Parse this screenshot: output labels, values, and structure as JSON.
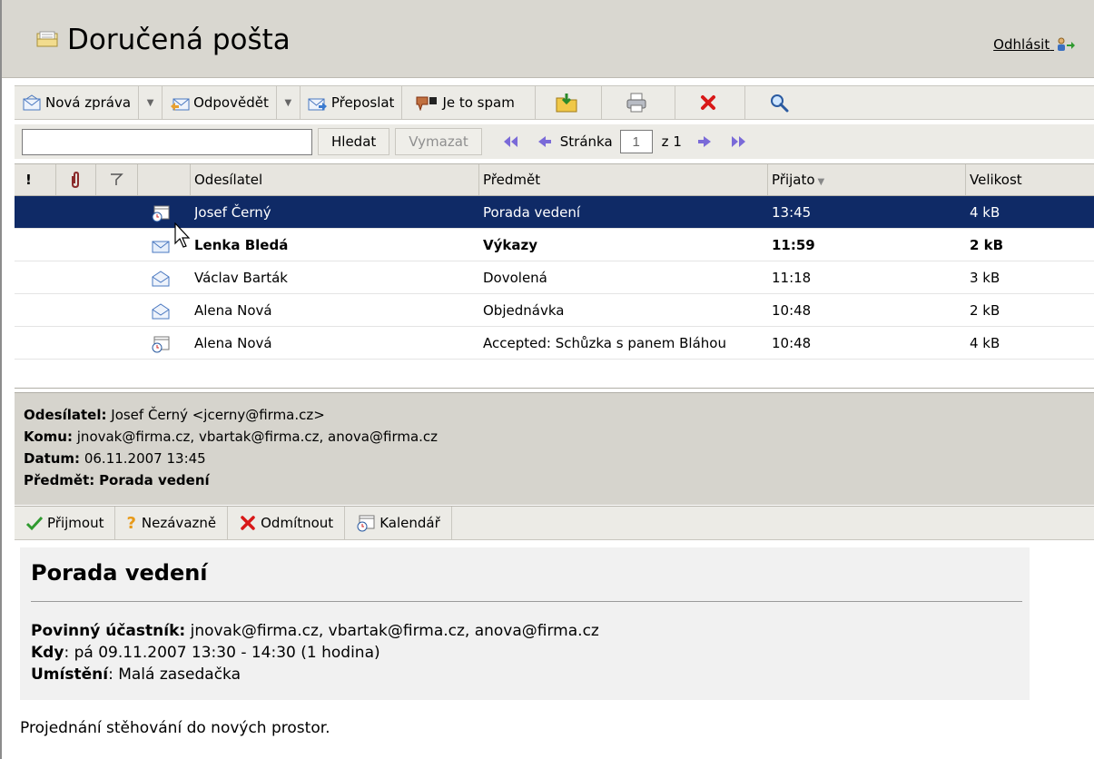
{
  "header": {
    "title": "Doručená pošta",
    "logout_label": "Odhlásit"
  },
  "toolbar": {
    "new_message": "Nová zpráva",
    "reply": "Odpovědět",
    "forward": "Přeposlat",
    "spam": "Je to spam"
  },
  "search": {
    "value": "",
    "search_label": "Hledat",
    "clear_label": "Vymazat",
    "page_label": "Stránka",
    "page_value": "1",
    "page_total": "z 1"
  },
  "columns": {
    "importance": "!",
    "sender": "Odesílatel",
    "subject": "Předmět",
    "received": "Přijato",
    "size": "Velikost"
  },
  "messages": [
    {
      "sender": "Josef Černý",
      "subject": "Porada vedení",
      "time": "13:45",
      "size": "4 kB",
      "icon": "meeting-request-icon",
      "selected": true,
      "unread": false
    },
    {
      "sender": "Lenka Bledá",
      "subject": "Výkazy",
      "time": "11:59",
      "size": "2 kB",
      "icon": "unread-envelope-icon",
      "selected": false,
      "unread": true
    },
    {
      "sender": "Václav Barták",
      "subject": "Dovolená",
      "time": "11:18",
      "size": "3 kB",
      "icon": "read-envelope-icon",
      "selected": false,
      "unread": false
    },
    {
      "sender": "Alena Nová",
      "subject": "Objednávka",
      "time": "10:48",
      "size": "2 kB",
      "icon": "read-envelope-icon",
      "selected": false,
      "unread": false
    },
    {
      "sender": "Alena Nová",
      "subject": "Accepted: Schůzka s panem Bláhou",
      "time": "10:48",
      "size": "4 kB",
      "icon": "meeting-response-icon",
      "selected": false,
      "unread": false
    }
  ],
  "preview": {
    "sender_label": "Odesílatel:",
    "sender_value": "Josef Černý <jcerny@firma.cz>",
    "to_label": "Komu:",
    "to_value": "jnovak@firma.cz, vbartak@firma.cz, anova@firma.cz",
    "date_label": "Datum:",
    "date_value": "06.11.2007 13:45",
    "subject_label": "Předmět:",
    "subject_value": "Porada vedení"
  },
  "invite_toolbar": {
    "accept": "Přijmout",
    "tentative": "Nezávazně",
    "decline": "Odmítnout",
    "calendar": "Kalendář"
  },
  "invitation": {
    "title": "Porada vedení",
    "required_label": "Povinný účastník:",
    "required_value": "jnovak@firma.cz, vbartak@firma.cz, anova@firma.cz",
    "when_label": "Kdy",
    "when_value": "pá 09.11.2007 13:30 - 14:30 (1 hodina)",
    "location_label": "Umístění",
    "location_value": "Malá zasedačka",
    "body": "Projednání stěhování do nových prostor."
  },
  "colors": {
    "selected_row": "#0f2a66",
    "toolbar_bg": "#ecebe6",
    "title_bg": "#d9d7d0"
  }
}
